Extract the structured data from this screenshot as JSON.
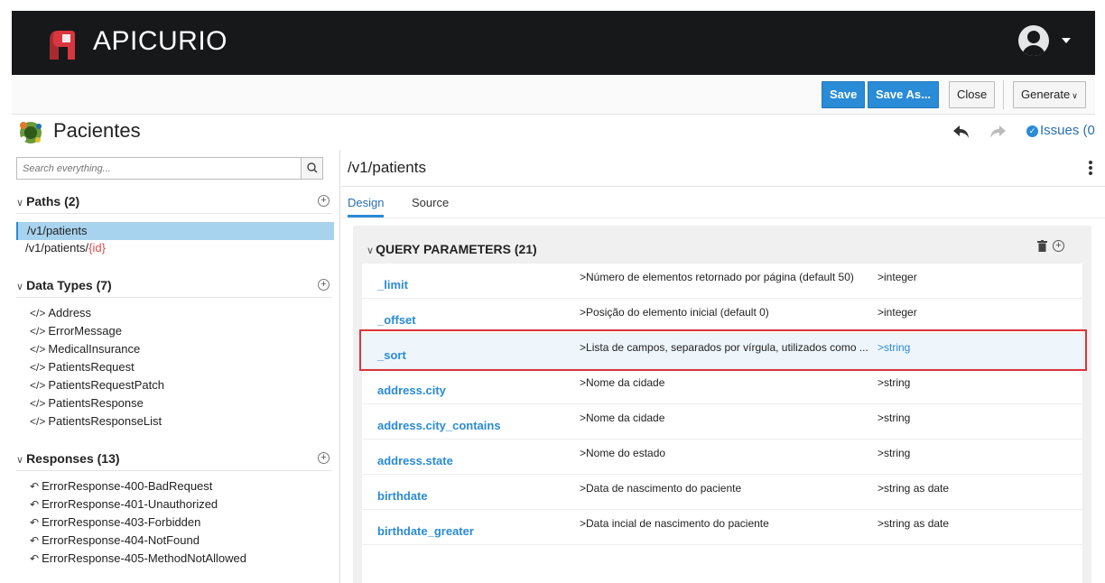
{
  "app": {
    "brand": "APICURIO"
  },
  "toolbar": {
    "save": "Save",
    "save_as": "Save As...",
    "close": "Close",
    "generate": "Generate"
  },
  "document": {
    "title": "Pacientes",
    "issues": "Issues (0"
  },
  "search": {
    "placeholder": "Search everything..."
  },
  "paths": {
    "header": "Paths (2)",
    "items": [
      {
        "label": "/v1/patients"
      },
      {
        "label": "/v1/patients/",
        "param": "{id}"
      }
    ]
  },
  "data_types": {
    "header": "Data Types (7)",
    "items": [
      "Address",
      "ErrorMessage",
      "MedicalInsurance",
      "PatientsRequest",
      "PatientsRequestPatch",
      "PatientsResponse",
      "PatientsResponseList"
    ]
  },
  "responses": {
    "header": "Responses (13)",
    "items": [
      "ErrorResponse-400-BadRequest",
      "ErrorResponse-401-Unauthorized",
      "ErrorResponse-403-Forbidden",
      "ErrorResponse-404-NotFound",
      "ErrorResponse-405-MethodNotAllowed"
    ]
  },
  "editor": {
    "path": "/v1/patients",
    "tabs": [
      "Design",
      "Source"
    ],
    "query_params_header": "QUERY PARAMETERS (21)",
    "params": [
      {
        "name": "_limit",
        "desc": "Número de elementos retornado por página (default 50)",
        "type": "integer"
      },
      {
        "name": "_offset",
        "desc": "Posição do elemento inicial (default 0)",
        "type": "integer"
      },
      {
        "name": "_sort",
        "desc": "Lista de campos, separados por vírgula, utilizados como ...",
        "type": "string"
      },
      {
        "name": "address.city",
        "desc": "Nome da cidade",
        "type": "string"
      },
      {
        "name": "address.city_contains",
        "desc": "Nome da cidade",
        "type": "string"
      },
      {
        "name": "address.state",
        "desc": "Nome do estado",
        "type": "string"
      },
      {
        "name": "birthdate",
        "desc": "Data de nascimento do paciente",
        "type": "string as date"
      },
      {
        "name": "birthdate_greater",
        "desc": "Data incial de nascimento do paciente",
        "type": "string as date"
      }
    ]
  },
  "colors": {
    "header_bg": "#16181a",
    "primary": "#2a8bd6",
    "active_path": "#a8d3ee",
    "highlight": "#d9363e",
    "path_param": "#e04848"
  }
}
